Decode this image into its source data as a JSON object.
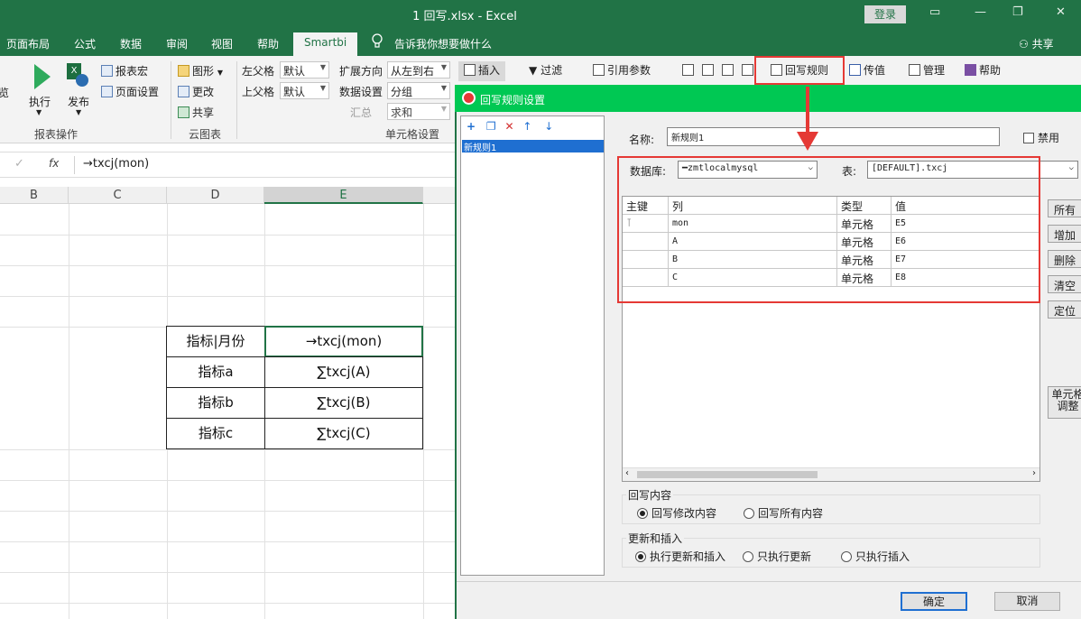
{
  "window": {
    "title": "1 回写.xlsx  -  Excel",
    "login": "登录"
  },
  "menu": {
    "tabs": [
      "页面布局",
      "公式",
      "数据",
      "审阅",
      "视图",
      "帮助"
    ],
    "active_tab": "Smartbi",
    "tell_me": "告诉我你想要做什么",
    "share": "共享"
  },
  "ribbon": {
    "preview_partial": "览",
    "execute": "执行",
    "publish": "发布",
    "report_macro": "报表宏",
    "page_setup": "页面设置",
    "group_report_ops": "报表操作",
    "chart": "图形",
    "change": "更改",
    "share": "共享",
    "group_cloud": "云图表",
    "left_parent": "左父格",
    "top_parent": "上父格",
    "left_parent_val": "默认",
    "top_parent_val": "默认",
    "expand_dir": "扩展方向",
    "data_setting": "数据设置",
    "summary": "汇总",
    "expand_val": "从左到右",
    "data_val": "分组",
    "summary_val": "求和",
    "group_cell": "单元格设置"
  },
  "formula": {
    "cancel": "✓",
    "fx": "fx",
    "value": "→txcj(mon)"
  },
  "sheet": {
    "columns": [
      "B",
      "C",
      "D",
      "E"
    ],
    "selected_column": "E",
    "table": [
      [
        "指标|月份",
        "→txcj(mon)"
      ],
      [
        "指标a",
        "∑txcj(A)"
      ],
      [
        "指标b",
        "∑txcj(B)"
      ],
      [
        "指标c",
        "∑txcj(C)"
      ]
    ]
  },
  "right_toolbar": {
    "insert": "插入",
    "filter": "过滤",
    "ref_params": "引用参数",
    "writeback_rule": "回写规则",
    "pass_value": "传值",
    "manage": "管理",
    "help": "帮助"
  },
  "dialog": {
    "title": "回写规则设置",
    "rules": [
      "新规则1"
    ],
    "name_label": "名称:",
    "name_value": "新规则1",
    "disable_label": "禁用",
    "db_label": "数据库:",
    "db_value": "zmtlocalmysql",
    "table_label": "表:",
    "table_value": "[DEFAULT].txcj",
    "grid_headers": [
      "主键",
      "列",
      "类型",
      "值"
    ],
    "grid_rows": [
      {
        "key": true,
        "col": "mon",
        "type": "单元格",
        "value": "E5"
      },
      {
        "key": false,
        "col": "A",
        "type": "单元格",
        "value": "E6"
      },
      {
        "key": false,
        "col": "B",
        "type": "单元格",
        "value": "E7"
      },
      {
        "key": false,
        "col": "C",
        "type": "单元格",
        "value": "E8"
      }
    ],
    "side_buttons": [
      "所有",
      "增加",
      "删除",
      "清空",
      "定位"
    ],
    "cell_adjust_1": "单元格",
    "cell_adjust_2": "调整",
    "writeback_content_label": "回写内容",
    "wb_modified": "回写修改内容",
    "wb_all": "回写所有内容",
    "update_insert_label": "更新和插入",
    "ui_both": "执行更新和插入",
    "ui_update": "只执行更新",
    "ui_insert": "只执行插入",
    "ok": "确定",
    "cancel": "取消"
  }
}
